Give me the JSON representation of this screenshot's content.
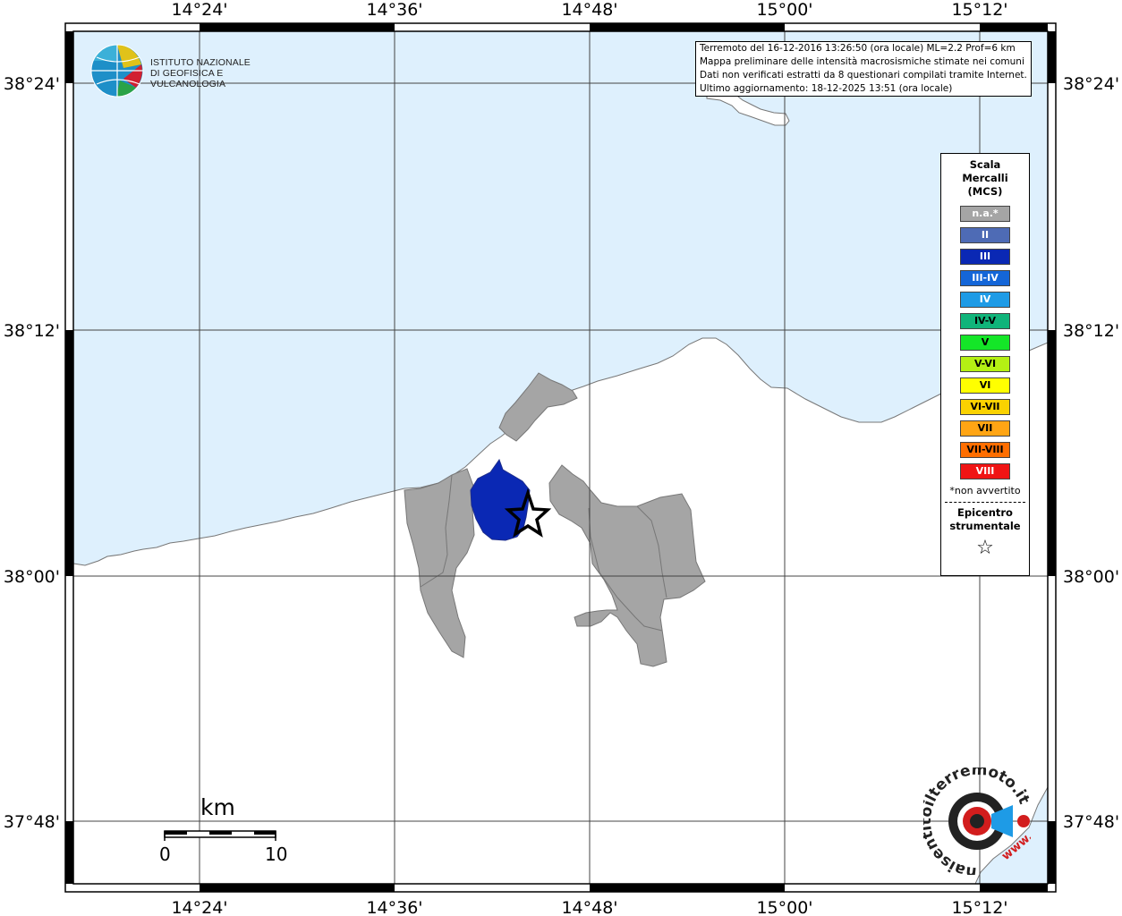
{
  "map": {
    "lon_labels": [
      "14°24'",
      "14°36'",
      "14°48'",
      "15°00'",
      "15°12'"
    ],
    "lat_labels": [
      "38°24'",
      "38°12'",
      "38°00'",
      "37°48'"
    ],
    "colors": {
      "sea": "#def0fd",
      "land": "#ffffff",
      "gray_commune": "#a5a5a5",
      "blue_commune": "#0a28b4",
      "coast": "#777777"
    }
  },
  "logo": {
    "line1": "ISTITUTO NAZIONALE",
    "line2": "DI GEOFISICA E VULCANOLOGIA"
  },
  "info": {
    "line1": "Terremoto del 16-12-2016 13:26:50 (ora locale) ML=2.2 Prof=6 km",
    "line2": "Mappa preliminare delle intensità macrosismiche stimate nei comuni",
    "line3": "Dati non verificati estratti da 8 questionari compilati tramite Internet.",
    "line4": "Ultimo aggiornamento: 18-12-2025 13:51 (ora locale)"
  },
  "legend": {
    "title1": "Scala",
    "title2": "Mercalli",
    "title3": "(MCS)",
    "items": [
      {
        "label": "n.a.*",
        "color": "#a5a5a5",
        "text": "light"
      },
      {
        "label": "II",
        "color": "#4e6bb5",
        "text": "light"
      },
      {
        "label": "III",
        "color": "#0a28b4",
        "text": "light"
      },
      {
        "label": "III-IV",
        "color": "#1466d8",
        "text": "light"
      },
      {
        "label": "IV",
        "color": "#1e9be6",
        "text": "light"
      },
      {
        "label": "IV-V",
        "color": "#10b47a",
        "text": "dark"
      },
      {
        "label": "V",
        "color": "#14e628",
        "text": "dark"
      },
      {
        "label": "V-VI",
        "color": "#b4f014",
        "text": "dark"
      },
      {
        "label": "VI",
        "color": "#ffff00",
        "text": "dark"
      },
      {
        "label": "VI-VII",
        "color": "#fad200",
        "text": "dark"
      },
      {
        "label": "VII",
        "color": "#ffa514",
        "text": "dark"
      },
      {
        "label": "VII-VIII",
        "color": "#ff6e00",
        "text": "dark"
      },
      {
        "label": "VIII",
        "color": "#f01414",
        "text": "light"
      }
    ],
    "note": "*non avvertito",
    "epi1": "Epicentro",
    "epi2": "strumentale",
    "star": "☆"
  },
  "scalebar": {
    "unit": "km",
    "start": "0",
    "end": "10"
  },
  "hsl_logo": {
    "text": "haisentitoilterremoto.it",
    "www": "www."
  }
}
